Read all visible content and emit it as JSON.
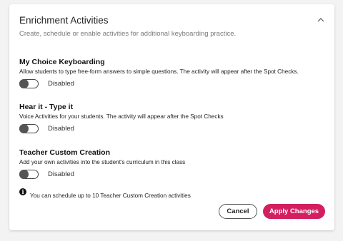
{
  "card": {
    "title": "Enrichment Activities",
    "subtitle": "Create, schedule or enable activities for additional keyboarding practice."
  },
  "sections": [
    {
      "title": "My Choice Keyboarding",
      "description": "Allow students to type free-form answers to simple questions. The activity will appear after the Spot Checks.",
      "toggle_label": "Disabled",
      "enabled": false
    },
    {
      "title": "Hear it - Type it",
      "description": "Voice Activities for your students. The activity will appear after the Spot Checks",
      "toggle_label": "Disabled",
      "enabled": false
    },
    {
      "title": "Teacher Custom Creation",
      "description": "Add your own activities into the student's curriculum in this class",
      "toggle_label": "Disabled",
      "enabled": false
    }
  ],
  "info": {
    "icon": "info-icon",
    "glyph": "i",
    "text": "You can schedule up to 10 Teacher Custom Creation activities"
  },
  "actions": {
    "cancel_label": "Cancel",
    "apply_label": "Apply Changes"
  },
  "colors": {
    "accent": "#d31f5f"
  }
}
